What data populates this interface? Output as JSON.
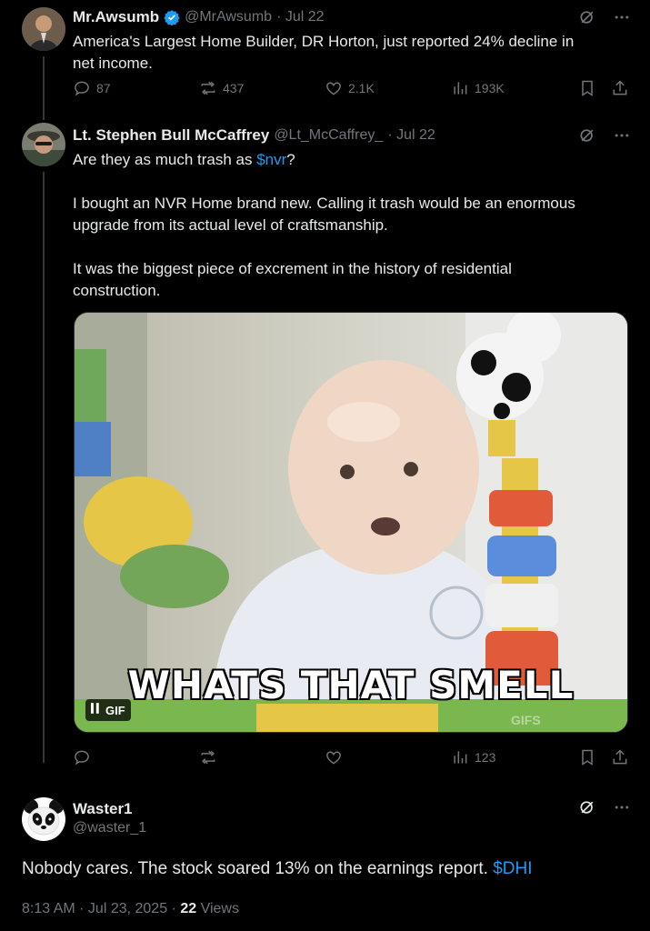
{
  "tweet1": {
    "name": "Mr.Awsumb",
    "handle": "@MrAwsumb",
    "date": "· Jul 22",
    "text_line1": "America's Largest Home Builder, DR Horton, just reported 24% decline in",
    "text_line2": "net income.",
    "replies": "87",
    "reposts": "437",
    "likes": "2.1K",
    "views": "193K"
  },
  "tweet2": {
    "name": "Lt. Stephen Bull McCaffrey",
    "handle": "@Lt_McCaffrey_",
    "date": "· Jul 22",
    "line1_pre": "Are they as much trash as ",
    "line1_cashtag": "$nvr",
    "line1_post": "?",
    "para2_line1": "I bought an NVR Home brand new. Calling it trash would be an enormous",
    "para2_line2": "upgrade from its actual level of craftsmanship.",
    "para3_line1": "It was the biggest piece of excrement in the history of residential",
    "para3_line2": "construction.",
    "gif_caption": "WHATS THAT SMELL",
    "gif_badge": "GIF",
    "gif_watermark": "GIFS",
    "views": "123"
  },
  "tweet3": {
    "name": "Waster1",
    "handle": "@waster_1",
    "text_pre": "Nobody cares. The stock soared 13% on the earnings report. ",
    "text_cashtag": "$DHI",
    "timestamp": "8:13 AM · Jul 23, 2025 · ",
    "views_count": "22",
    "views_label": " Views"
  },
  "colors": {
    "background": "#000000",
    "text": "#e7e9ea",
    "muted": "#71767b",
    "link": "#1d9bf0",
    "verified": "#1d9bf0"
  }
}
